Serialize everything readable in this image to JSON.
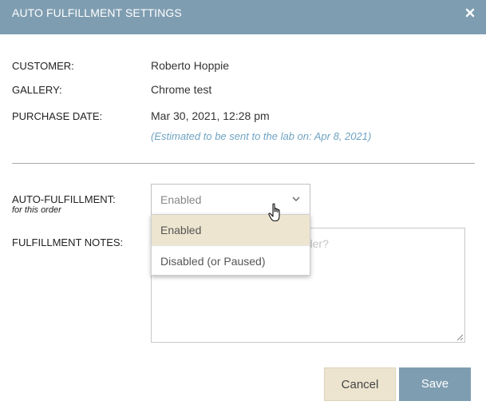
{
  "dialog": {
    "title": "AUTO FULFILLMENT SETTINGS",
    "close_icon": "close-icon"
  },
  "details": {
    "customer_label": "CUSTOMER:",
    "customer_value": "Roberto Hoppie",
    "gallery_label": "GALLERY:",
    "gallery_value": "Chrome test",
    "purchase_date_label": "PURCHASE DATE:",
    "purchase_date_value": "Mar 30, 2021, 12:28 pm",
    "estimate_note": "(Estimated to be sent to the lab on: Apr 8, 2021)"
  },
  "auto_fulfillment": {
    "label": "AUTO-FULFILLMENT:",
    "sub_label": "for this order",
    "selected_value": "Enabled",
    "options": [
      "Enabled",
      "Disabled (or Paused)"
    ],
    "dropdown_open": true
  },
  "notes": {
    "label": "FULFILLMENT NOTES:",
    "placeholder": "Special instructions for this order?"
  },
  "actions": {
    "cancel_label": "Cancel",
    "save_label": "Save"
  },
  "colors": {
    "header": "#7f9db1",
    "cancel": "#ece4cf",
    "highlight": "#ede5cf",
    "note_text": "#6fa3c2"
  }
}
